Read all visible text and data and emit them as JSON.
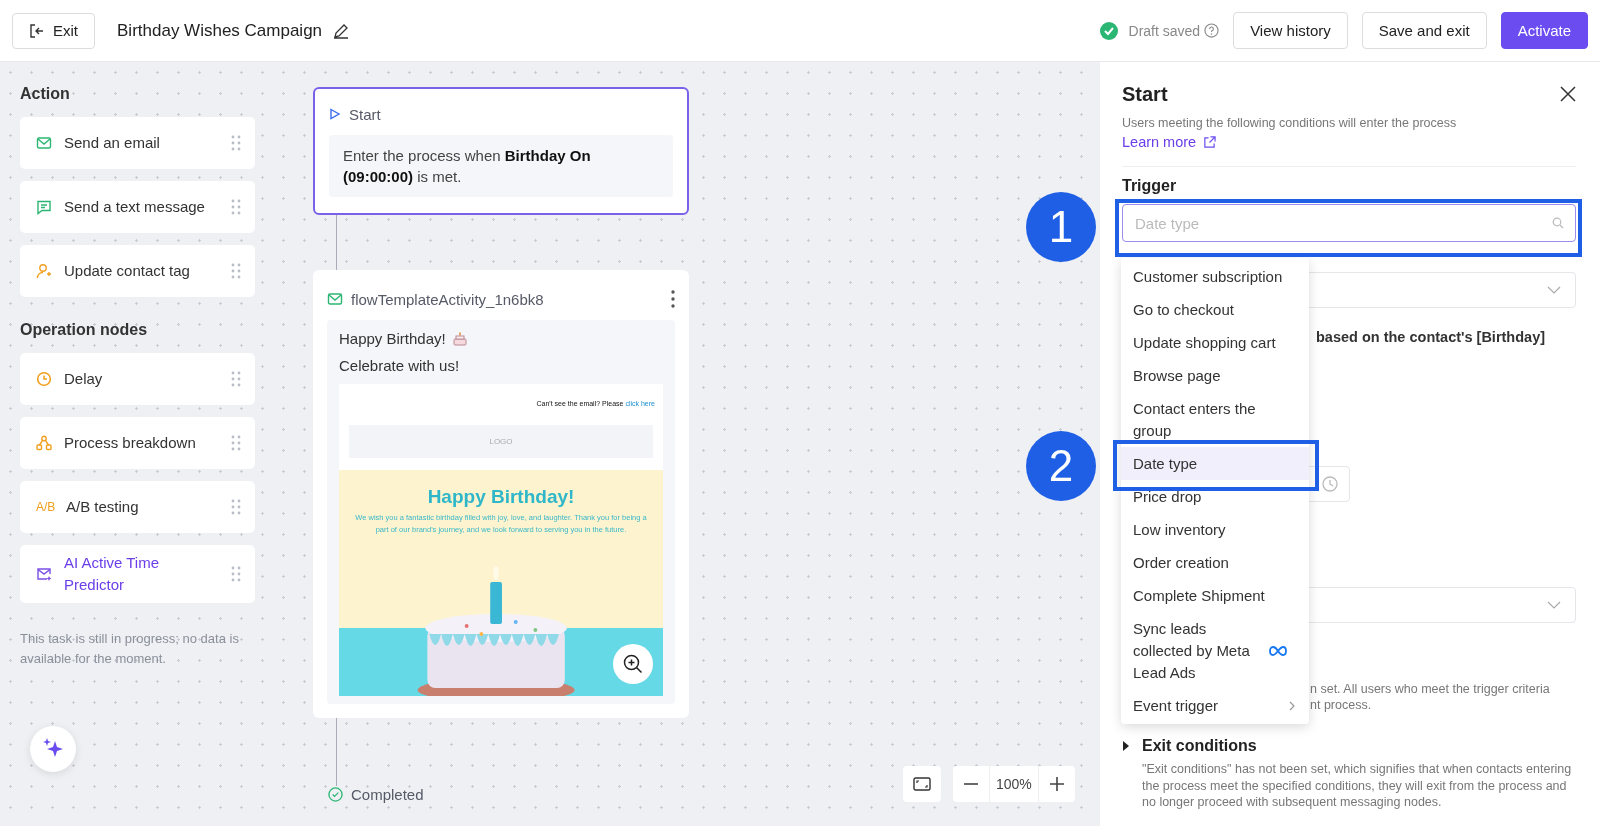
{
  "header": {
    "exit": "Exit",
    "title": "Birthday Wishes Campaign",
    "status": "Draft saved",
    "buttons": [
      {
        "label": "View history",
        "kind": "secondary"
      },
      {
        "label": "Save and exit",
        "kind": "secondary"
      },
      {
        "label": "Activate",
        "kind": "primary"
      }
    ]
  },
  "palette": {
    "sections": [
      {
        "title": "Action",
        "items": [
          {
            "label": "Send an email",
            "kind": "email",
            "accent": false
          },
          {
            "label": "Send a text message",
            "kind": "sms",
            "accent": false
          },
          {
            "label": "Update contact tag",
            "kind": "tag",
            "accent": false
          }
        ]
      },
      {
        "title": "Operation nodes",
        "items": [
          {
            "label": "Delay",
            "kind": "delay",
            "accent": false
          },
          {
            "label": "Process breakdown",
            "kind": "split",
            "accent": false
          },
          {
            "label": "A/B testing",
            "kind": "abtest",
            "icon_text": "A/B",
            "accent": false
          },
          {
            "label": "AI Active Time Predictor",
            "kind": "predictor",
            "accent": true
          }
        ]
      }
    ],
    "note": "This task is still in progress; no data is available for the moment."
  },
  "flow": {
    "start_node": {
      "title": "Start",
      "text": "Enter the process when **Birthday On (09:00:00)** is met.",
      "selected": true
    },
    "email_node": {
      "name": "flowTemplateActivity_1n6bk8",
      "subject": "Happy Birthday!",
      "preheader": "Celebrate with us!",
      "preview": {
        "notice": "Can't see the email? Please",
        "notice_link": "click here",
        "logo": "LOGO",
        "heading": "Happy Birthday!",
        "body": "We wish you a fantastic birthday filled with joy, love, and laughter. Thank you for being a part of our brand's journey, and we look forward to serving you in the future."
      }
    },
    "end": "Completed"
  },
  "zoom": {
    "value": "100%"
  },
  "panel": {
    "title": "Start",
    "description": "Users meeting the following conditions will enter the process",
    "learn_more": "Learn more",
    "trigger_label": "Trigger",
    "trigger_field": {
      "placeholder": "Date type"
    },
    "partial_text_1": "based on the contact's [Birthday]",
    "partial_text_2": "n set. All users who meet the trigger criteria",
    "partial_text_3": "nt process.",
    "exit_title": "Exit conditions",
    "exit_expanded": false,
    "exit_text": "\"Exit conditions\" has not been set, which signifies that when contacts entering the process meet the specified conditions, they will exit from the process and no longer proceed with subsequent messaging nodes."
  },
  "dropdown": {
    "items": [
      {
        "label": "Customer subscription",
        "kind": "plain",
        "selected": false
      },
      {
        "label": "Go to checkout",
        "kind": "plain",
        "selected": false
      },
      {
        "label": "Update shopping cart",
        "kind": "plain",
        "selected": false
      },
      {
        "label": "Browse page",
        "kind": "plain",
        "selected": false
      },
      {
        "label": "Contact enters the group",
        "kind": "plain",
        "selected": false
      },
      {
        "label": "Date type",
        "kind": "plain",
        "selected": true
      },
      {
        "label": "Price drop",
        "kind": "plain",
        "selected": false
      },
      {
        "label": "Low inventory",
        "kind": "plain",
        "selected": false
      },
      {
        "label": "Order creation",
        "kind": "plain",
        "selected": false
      },
      {
        "label": "Complete Shipment",
        "kind": "plain",
        "selected": false
      },
      {
        "label": "Sync leads collected by Meta Lead Ads",
        "kind": "meta",
        "selected": false
      },
      {
        "label": "Event trigger",
        "kind": "submenu",
        "selected": false
      }
    ]
  },
  "annotations": [
    {
      "label": "1"
    },
    {
      "label": "2"
    }
  ]
}
